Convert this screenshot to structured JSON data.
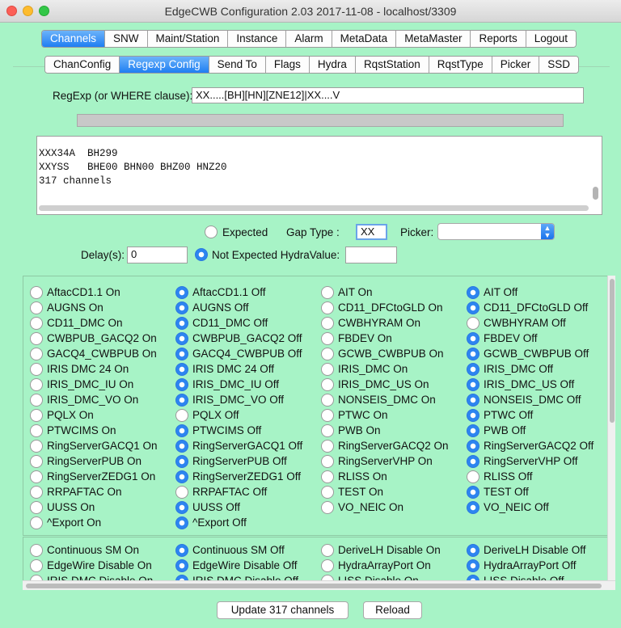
{
  "window": {
    "title": "EdgeCWB Configuration 2.03 2017-11-08 - localhost/3309"
  },
  "main_tabs": [
    "Channels",
    "SNW",
    "Maint/Station",
    "Instance",
    "Alarm",
    "MetaData",
    "MetaMaster",
    "Reports",
    "Logout"
  ],
  "main_tab_selected": "Channels",
  "sub_tabs": [
    "ChanConfig",
    "Regexp Config",
    "Send To",
    "Flags",
    "Hydra",
    "RqstStation",
    "RqstType",
    "Picker",
    "SSD"
  ],
  "sub_tab_selected": "Regexp Config",
  "regexp": {
    "label": "RegExp (or WHERE clause):",
    "value": "XX.....[BH][HN][ZNE12]|XX....V"
  },
  "results": {
    "lines": [
      "XXX34A  BH299",
      "XXYSS   BHE00 BHN00 BHZ00 HNZ20",
      "317 channels"
    ]
  },
  "options": {
    "expected_label": "Expected",
    "gap_type_label": "Gap Type :",
    "gap_type_value": "XX",
    "picker_label": "Picker:",
    "picker_value": "",
    "delay_label": "Delay(s):",
    "delay_value": "0",
    "not_expected_label": "Not Expected HydraValue:",
    "hydra_value": "",
    "expected_selected": false,
    "not_expected_selected": true
  },
  "flag_rows": [
    {
      "cells": [
        {
          "label": "AftacCD1.1 On",
          "selected": false
        },
        {
          "label": "AftacCD1.1 Off",
          "selected": true
        },
        {
          "label": "AIT On",
          "selected": false
        },
        {
          "label": "AIT Off",
          "selected": true
        }
      ]
    },
    {
      "cells": [
        {
          "label": "AUGNS On",
          "selected": false
        },
        {
          "label": "AUGNS Off",
          "selected": true
        },
        {
          "label": "CD11_DFCtoGLD On",
          "selected": false
        },
        {
          "label": "CD11_DFCtoGLD Off",
          "selected": true
        }
      ]
    },
    {
      "cells": [
        {
          "label": "CD11_DMC On",
          "selected": false
        },
        {
          "label": "CD11_DMC Off",
          "selected": true
        },
        {
          "label": "CWBHYRAM On",
          "selected": false
        },
        {
          "label": "CWBHYRAM Off",
          "selected": false
        }
      ]
    },
    {
      "cells": [
        {
          "label": "CWBPUB_GACQ2 On",
          "selected": false
        },
        {
          "label": "CWBPUB_GACQ2 Off",
          "selected": true
        },
        {
          "label": "FBDEV On",
          "selected": false
        },
        {
          "label": "FBDEV Off",
          "selected": true
        }
      ]
    },
    {
      "cells": [
        {
          "label": "GACQ4_CWBPUB On",
          "selected": false
        },
        {
          "label": "GACQ4_CWBPUB Off",
          "selected": true
        },
        {
          "label": "GCWB_CWBPUB On",
          "selected": false
        },
        {
          "label": "GCWB_CWBPUB Off",
          "selected": true
        }
      ]
    },
    {
      "cells": [
        {
          "label": "IRIS DMC 24 On",
          "selected": false
        },
        {
          "label": "IRIS DMC 24 Off",
          "selected": true
        },
        {
          "label": "IRIS_DMC On",
          "selected": false
        },
        {
          "label": "IRIS_DMC Off",
          "selected": true
        }
      ]
    },
    {
      "cells": [
        {
          "label": "IRIS_DMC_IU On",
          "selected": false
        },
        {
          "label": "IRIS_DMC_IU Off",
          "selected": true
        },
        {
          "label": "IRIS_DMC_US On",
          "selected": false
        },
        {
          "label": "IRIS_DMC_US Off",
          "selected": true
        }
      ]
    },
    {
      "cells": [
        {
          "label": "IRIS_DMC_VO On",
          "selected": false
        },
        {
          "label": "IRIS_DMC_VO Off",
          "selected": true
        },
        {
          "label": "NONSEIS_DMC On",
          "selected": false
        },
        {
          "label": "NONSEIS_DMC Off",
          "selected": true
        }
      ]
    },
    {
      "cells": [
        {
          "label": "PQLX On",
          "selected": false
        },
        {
          "label": "PQLX Off",
          "selected": false
        },
        {
          "label": "PTWC On",
          "selected": false
        },
        {
          "label": "PTWC Off",
          "selected": true
        }
      ]
    },
    {
      "cells": [
        {
          "label": "PTWCIMS On",
          "selected": false
        },
        {
          "label": "PTWCIMS Off",
          "selected": true
        },
        {
          "label": "PWB On",
          "selected": false
        },
        {
          "label": "PWB Off",
          "selected": true
        }
      ]
    },
    {
      "cells": [
        {
          "label": "RingServerGACQ1 On",
          "selected": false
        },
        {
          "label": "RingServerGACQ1 Off",
          "selected": true
        },
        {
          "label": "RingServerGACQ2 On",
          "selected": false
        },
        {
          "label": "RingServerGACQ2 Off",
          "selected": true
        }
      ]
    },
    {
      "cells": [
        {
          "label": "RingServerPUB On",
          "selected": false
        },
        {
          "label": "RingServerPUB Off",
          "selected": true
        },
        {
          "label": "RingServerVHP On",
          "selected": false
        },
        {
          "label": "RingServerVHP Off",
          "selected": true
        }
      ]
    },
    {
      "cells": [
        {
          "label": "RingServerZEDG1 On",
          "selected": false
        },
        {
          "label": "RingServerZEDG1 Off",
          "selected": true
        },
        {
          "label": "RLISS On",
          "selected": false
        },
        {
          "label": "RLISS Off",
          "selected": false
        }
      ]
    },
    {
      "cells": [
        {
          "label": "RRPAFTAC On",
          "selected": false
        },
        {
          "label": "RRPAFTAC Off",
          "selected": false
        },
        {
          "label": "TEST On",
          "selected": false
        },
        {
          "label": "TEST Off",
          "selected": true
        }
      ]
    },
    {
      "cells": [
        {
          "label": "UUSS On",
          "selected": false
        },
        {
          "label": "UUSS Off",
          "selected": true
        },
        {
          "label": "VO_NEIC On",
          "selected": false
        },
        {
          "label": "VO_NEIC Off",
          "selected": true
        }
      ]
    },
    {
      "cells": [
        {
          "label": "^Export On",
          "selected": false
        },
        {
          "label": "^Export Off",
          "selected": true
        }
      ]
    }
  ],
  "option_rows": [
    {
      "cells": [
        {
          "label": "Continuous SM On",
          "selected": false
        },
        {
          "label": "Continuous SM Off",
          "selected": true
        },
        {
          "label": "DeriveLH Disable On",
          "selected": false
        },
        {
          "label": "DeriveLH Disable Off",
          "selected": true
        }
      ]
    },
    {
      "cells": [
        {
          "label": "EdgeWire Disable On",
          "selected": false
        },
        {
          "label": "EdgeWire Disable Off",
          "selected": true
        },
        {
          "label": "HydraArrayPort On",
          "selected": false
        },
        {
          "label": "HydraArrayPort Off",
          "selected": true
        }
      ]
    },
    {
      "cells": [
        {
          "label": "IRIS DMC Disable On",
          "selected": false
        },
        {
          "label": "IRIS DMC Disable Off",
          "selected": true
        },
        {
          "label": "LISS Disable On",
          "selected": false
        },
        {
          "label": "LISS Disable Off",
          "selected": true
        }
      ]
    }
  ],
  "buttons": {
    "update": "Update 317 channels",
    "reload": "Reload"
  }
}
